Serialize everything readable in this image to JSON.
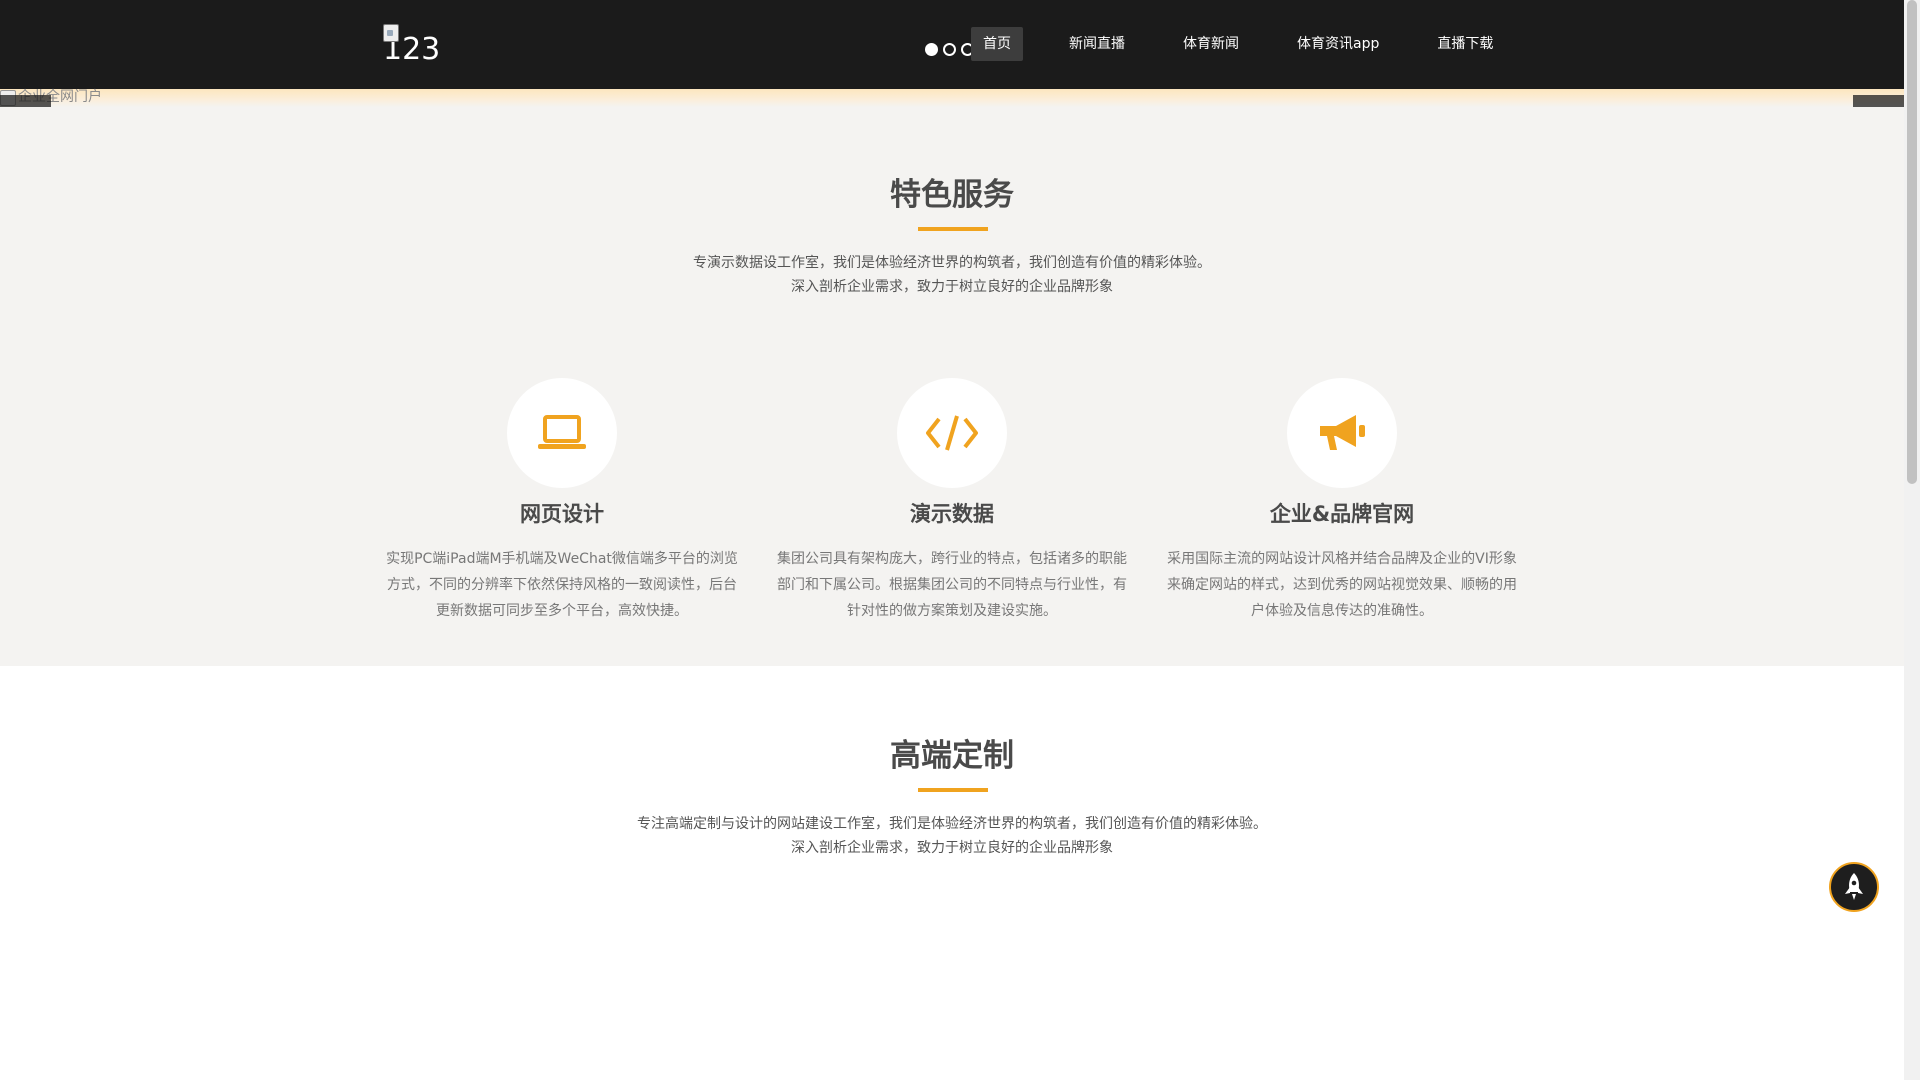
{
  "header": {
    "logo_alt": "123",
    "nav": [
      {
        "label": "首页",
        "active": true
      },
      {
        "label": "新闻直播",
        "active": false
      },
      {
        "label": "体育新闻",
        "active": false
      },
      {
        "label": "体育资讯app",
        "active": false
      },
      {
        "label": "直播下载",
        "active": false
      }
    ],
    "slider_dots": 3,
    "active_dot": 0
  },
  "banner": {
    "image_alt": "企业全网门户",
    "prev_icon": "chevron-left-icon",
    "next_icon": "chevron-right-icon"
  },
  "services": {
    "title": "特色服务",
    "desc_line1": "专演示数据设工作室，我们是体验经济世界的构筑者，我们创造有价值的精彩体验。",
    "desc_line2": "深入剖析企业需求，致力于树立良好的企业品牌形象",
    "items": [
      {
        "icon": "laptop-icon",
        "title": "网页设计",
        "text": "实现PC端iPad端M手机端及WeChat微信端多平台的浏览方式，不同的分辨率下依然保持风格的一致阅读性，后台更新数据可同步至多个平台，高效快捷。"
      },
      {
        "icon": "code-icon",
        "title": "演示数据",
        "text": "集团公司具有架构庞大，跨行业的特点，包括诸多的职能部门和下属公司。根据集团公司的不同特点与行业性，有针对性的做方案策划及建设实施。"
      },
      {
        "icon": "megaphone-icon",
        "title": "企业&品牌官网",
        "text": "采用国际主流的网站设计风格并结合品牌及企业的VI形象来确定网站的样式，达到优秀的网站视觉效果、顺畅的用户体验及信息传达的准确性。"
      }
    ]
  },
  "custom": {
    "title": "高端定制",
    "desc_line1": "专注高端定制与设计的网站建设工作室，我们是体验经济世界的构筑者，我们创造有价值的精彩体验。",
    "desc_line2": "深入剖析企业需求，致力于树立良好的企业品牌形象"
  },
  "back_to_top_icon": "rocket-icon",
  "colors": {
    "accent": "#f0a31f",
    "header_bg": "#1b1b1b",
    "section_bg": "#f4f3f1"
  }
}
